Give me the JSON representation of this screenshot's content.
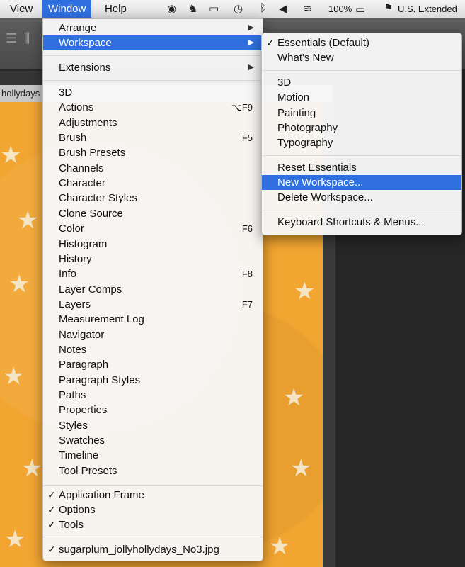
{
  "menubar": {
    "items": [
      "View",
      "Window",
      "Help"
    ],
    "battery": "100%",
    "input_source": "U.S. Extended",
    "status_icons": [
      "circle-a-icon",
      "evernote-icon",
      "airplay-icon",
      "time-machine-icon",
      "bluetooth-icon",
      "volume-icon",
      "wifi-icon",
      "battery-icon",
      "flag-icon"
    ]
  },
  "document": {
    "tab_title": "hollydays"
  },
  "window_menu": {
    "arrange": "Arrange",
    "workspace": "Workspace",
    "extensions": "Extensions",
    "panels": [
      {
        "label": "3D",
        "shortcut": ""
      },
      {
        "label": "Actions",
        "shortcut": "⌥F9"
      },
      {
        "label": "Adjustments",
        "shortcut": ""
      },
      {
        "label": "Brush",
        "shortcut": "F5"
      },
      {
        "label": "Brush Presets",
        "shortcut": ""
      },
      {
        "label": "Channels",
        "shortcut": ""
      },
      {
        "label": "Character",
        "shortcut": ""
      },
      {
        "label": "Character Styles",
        "shortcut": ""
      },
      {
        "label": "Clone Source",
        "shortcut": ""
      },
      {
        "label": "Color",
        "shortcut": "F6"
      },
      {
        "label": "Histogram",
        "shortcut": ""
      },
      {
        "label": "History",
        "shortcut": ""
      },
      {
        "label": "Info",
        "shortcut": "F8"
      },
      {
        "label": "Layer Comps",
        "shortcut": ""
      },
      {
        "label": "Layers",
        "shortcut": "F7"
      },
      {
        "label": "Measurement Log",
        "shortcut": ""
      },
      {
        "label": "Navigator",
        "shortcut": ""
      },
      {
        "label": "Notes",
        "shortcut": ""
      },
      {
        "label": "Paragraph",
        "shortcut": ""
      },
      {
        "label": "Paragraph Styles",
        "shortcut": ""
      },
      {
        "label": "Paths",
        "shortcut": ""
      },
      {
        "label": "Properties",
        "shortcut": ""
      },
      {
        "label": "Styles",
        "shortcut": ""
      },
      {
        "label": "Swatches",
        "shortcut": ""
      },
      {
        "label": "Timeline",
        "shortcut": ""
      },
      {
        "label": "Tool Presets",
        "shortcut": ""
      }
    ],
    "frame_items": [
      "Application Frame",
      "Options",
      "Tools"
    ],
    "document_item": "sugarplum_jollyhollydays_No3.jpg"
  },
  "workspace_menu": {
    "essentials": "Essentials (Default)",
    "whats_new": "What's New",
    "presets": [
      "3D",
      "Motion",
      "Painting",
      "Photography",
      "Typography"
    ],
    "reset": "Reset Essentials",
    "new": "New Workspace...",
    "delete": "Delete Workspace...",
    "shortcuts": "Keyboard Shortcuts & Menus..."
  },
  "colors": {
    "highlight": "#2f6fe0",
    "canvas": "#f2a531"
  }
}
